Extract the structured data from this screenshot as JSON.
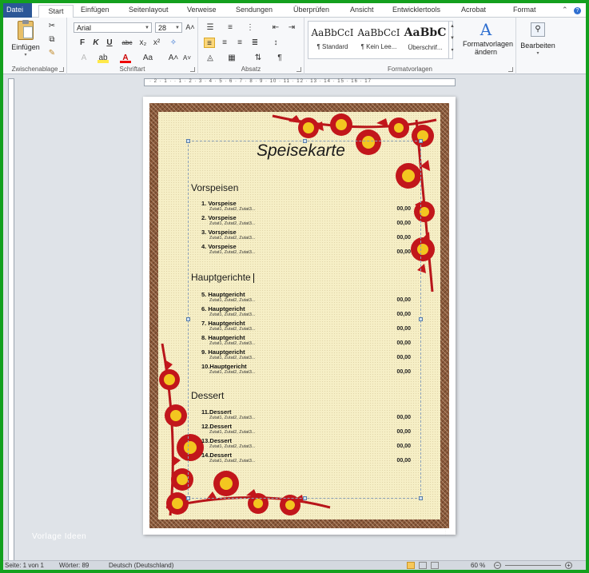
{
  "tabs": [
    "Datei",
    "Start",
    "Einfügen",
    "Seitenlayout",
    "Verweise",
    "Sendungen",
    "Überprüfen",
    "Ansicht",
    "Entwicklertools",
    "Acrobat",
    "Format"
  ],
  "ribbon": {
    "clipboard": {
      "paste_label": "Einfügen",
      "group_label": "Zwischenablage"
    },
    "font": {
      "name": "Arial",
      "size": "28",
      "group_label": "Schriftart"
    },
    "paragraph": {
      "group_label": "Absatz"
    },
    "styles": {
      "tiles": [
        {
          "sample": "AaBbCcI",
          "name": "¶ Standard"
        },
        {
          "sample": "AaBbCcI",
          "name": "¶ Kein Lee..."
        },
        {
          "sample": "AaBbC",
          "name": "Überschrif..."
        }
      ],
      "change_label": "Formatvorlagen ändern",
      "group_label": "Formatvorlagen"
    },
    "editing": {
      "label": "Bearbeiten"
    }
  },
  "ruler_numbers": "· 2 · 1 · · 1 · 2 · 3 · 4 · 5 · 6 · 7 · 8 · 9 · 10 · 11 · 12 · 13 · 14 · 15 · 16 · 17",
  "document": {
    "title": "Speisekarte",
    "sections": [
      {
        "heading": "Vorspeisen",
        "items": [
          {
            "name": "1.  Vorspeise",
            "desc": "Zutat1,  Zutat2,  Zutat3...",
            "price": "00,00"
          },
          {
            "name": "2.  Vorspeise",
            "desc": "Zutat1,  Zutat2,  Zutat3...",
            "price": "00,00"
          },
          {
            "name": "3.  Vorspeise",
            "desc": "Zutat1,  Zutat2,  Zutat3...",
            "price": "00,00"
          },
          {
            "name": "4.  Vorspeise",
            "desc": "Zutat1,  Zutat2,  Zutat3...",
            "price": "00,00"
          }
        ]
      },
      {
        "heading": "Hauptgerichte",
        "items": [
          {
            "name": "5.  Hauptgericht",
            "desc": "Zutat1,  Zutat2,  Zutat3...",
            "price": "00,00"
          },
          {
            "name": "6.  Hauptgericht",
            "desc": "Zutat1,  Zutat2,  Zutat3...",
            "price": "00,00"
          },
          {
            "name": "7.  Hauptgericht",
            "desc": "Zutat1,  Zutat2,  Zutat3...",
            "price": "00,00"
          },
          {
            "name": "8.  Hauptgericht",
            "desc": "Zutat1,  Zutat2,  Zutat3...",
            "price": "00,00"
          },
          {
            "name": "9.  Hauptgericht",
            "desc": "Zutat1,  Zutat2,  Zutat3...",
            "price": "00,00"
          },
          {
            "name": "10.Hauptgericht",
            "desc": "Zutat1,  Zutat2,  Zutat3...",
            "price": "00,00"
          }
        ]
      },
      {
        "heading": "Dessert",
        "items": [
          {
            "name": "11.Dessert",
            "desc": "Zutat1,  Zutat2,  Zutat3...",
            "price": "00,00"
          },
          {
            "name": "12.Dessert",
            "desc": "Zutat1,  Zutat2,  Zutat3...",
            "price": "00,00"
          },
          {
            "name": "13.Dessert",
            "desc": "Zutat1,  Zutat2,  Zutat3...",
            "price": "00,00"
          },
          {
            "name": "14.Dessert",
            "desc": "Zutat1,  Zutat2,  Zutat3...",
            "price": "00,00"
          }
        ]
      }
    ]
  },
  "watermark": "Vorlage Ideen",
  "status": {
    "page": "Seite: 1 von 1",
    "words": "Wörter: 89",
    "language": "Deutsch (Deutschland)",
    "zoom": "60 %"
  },
  "colors": {
    "file_tab": "#2b5797",
    "frame": "#14a01e",
    "paper": "#f6efc6",
    "border": "#8b5a3c",
    "petal": "#c2161b",
    "flower_center": "#f3c620"
  }
}
